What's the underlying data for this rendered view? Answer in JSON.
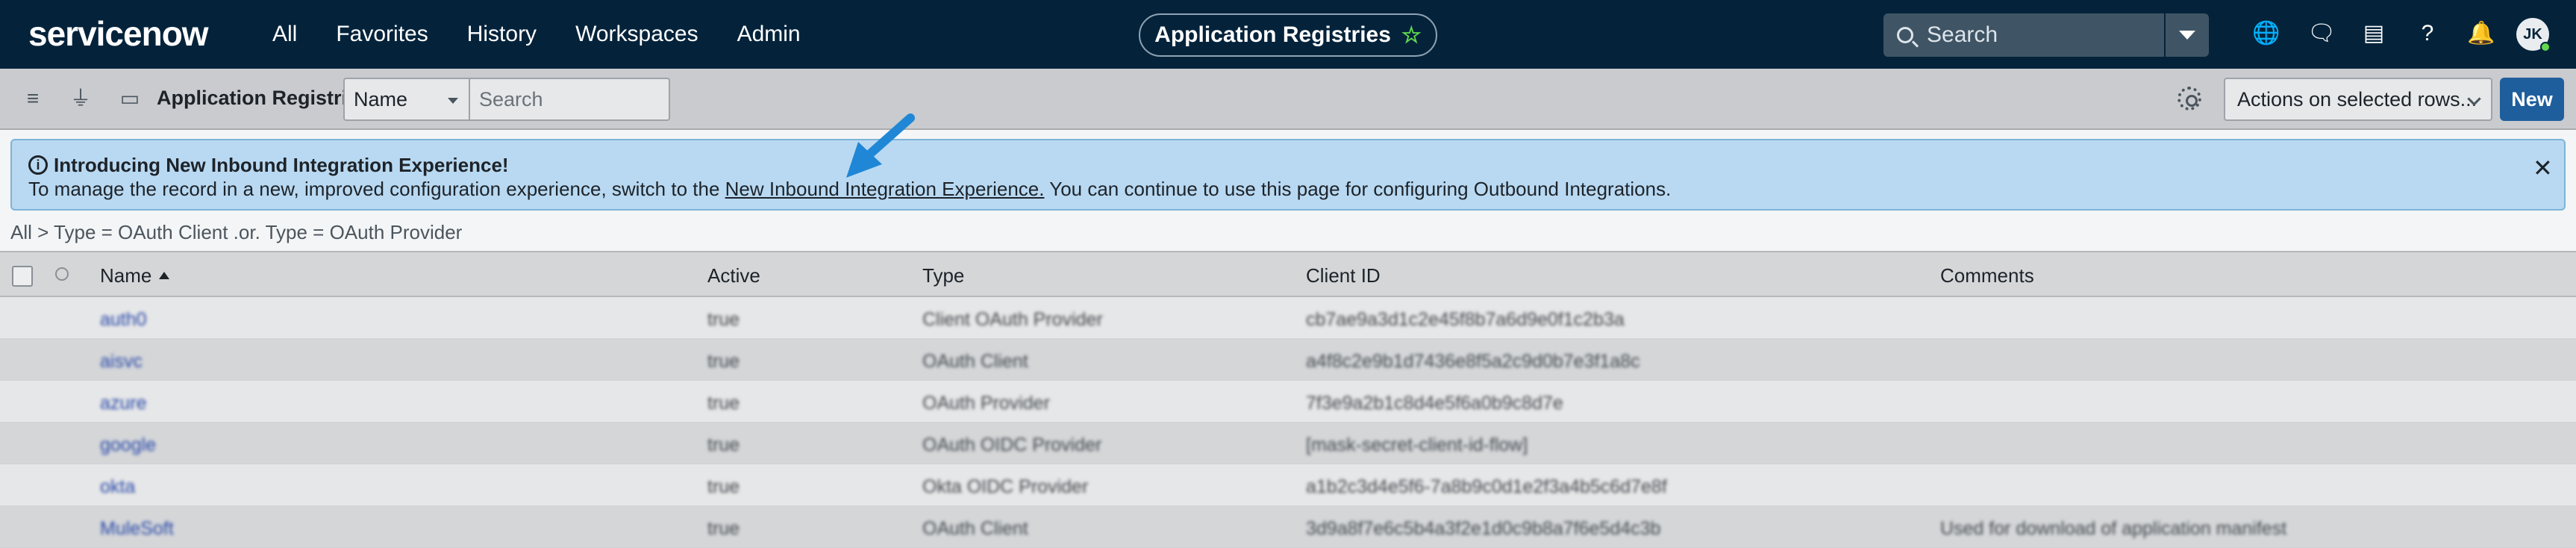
{
  "topnav": {
    "logo": "servicenow",
    "links": [
      "All",
      "Favorites",
      "History",
      "Workspaces",
      "Admin"
    ],
    "app_title": "Application Registries",
    "search_label": "Search",
    "avatar_initials": "JK"
  },
  "listbar": {
    "title": "Application Registries",
    "filter_field": "Name",
    "search_placeholder": "Search",
    "actions_label": "Actions on selected rows...",
    "new_label": "New"
  },
  "banner": {
    "title": "Introducing New Inbound Integration Experience!",
    "msg_before": "To manage the record in a new, improved configuration experience, switch to the ",
    "link_text": "New Inbound Integration Experience.",
    "msg_after": " You can continue to use this page for configuring Outbound Integrations."
  },
  "breadcrumb": "All > Type = OAuth Client .or. Type = OAuth Provider",
  "table": {
    "columns": [
      "Name",
      "Active",
      "Type",
      "Client ID",
      "Comments"
    ],
    "rows": [
      {
        "name": "auth0",
        "active": "true",
        "type": "Client OAuth Provider",
        "client_id": "cb7ae9a3d1c2e45f8b7a6d9e0f1c2b3a",
        "comments": ""
      },
      {
        "name": "aisvc",
        "active": "true",
        "type": "OAuth Client",
        "client_id": "a4f8c2e9b1d7436e8f5a2c9d0b7e3f1a8c",
        "comments": ""
      },
      {
        "name": "azure",
        "active": "true",
        "type": "OAuth Provider",
        "client_id": "7f3e9a2b1c8d4e5f6a0b9c8d7e",
        "comments": ""
      },
      {
        "name": "google",
        "active": "true",
        "type": "OAuth OIDC Provider",
        "client_id": "[mask-secret-client-id-flow]",
        "comments": ""
      },
      {
        "name": "okta",
        "active": "true",
        "type": "Okta OIDC Provider",
        "client_id": "a1b2c3d4e5f6-7a8b9c0d1e2f3a4b5c6d7e8f",
        "comments": ""
      },
      {
        "name": "MuleSoft",
        "active": "true",
        "type": "OAuth Client",
        "client_id": "3d9a8f7e6c5b4a3f2e1d0c9b8a7f6e5d4c3b",
        "comments": "Used for download of application manifest"
      }
    ]
  },
  "colors": {
    "nav_bg": "#04233b",
    "accent_green": "#62d84e",
    "banner_bg": "#b9d9f2",
    "primary_button": "#1f5e9c"
  }
}
